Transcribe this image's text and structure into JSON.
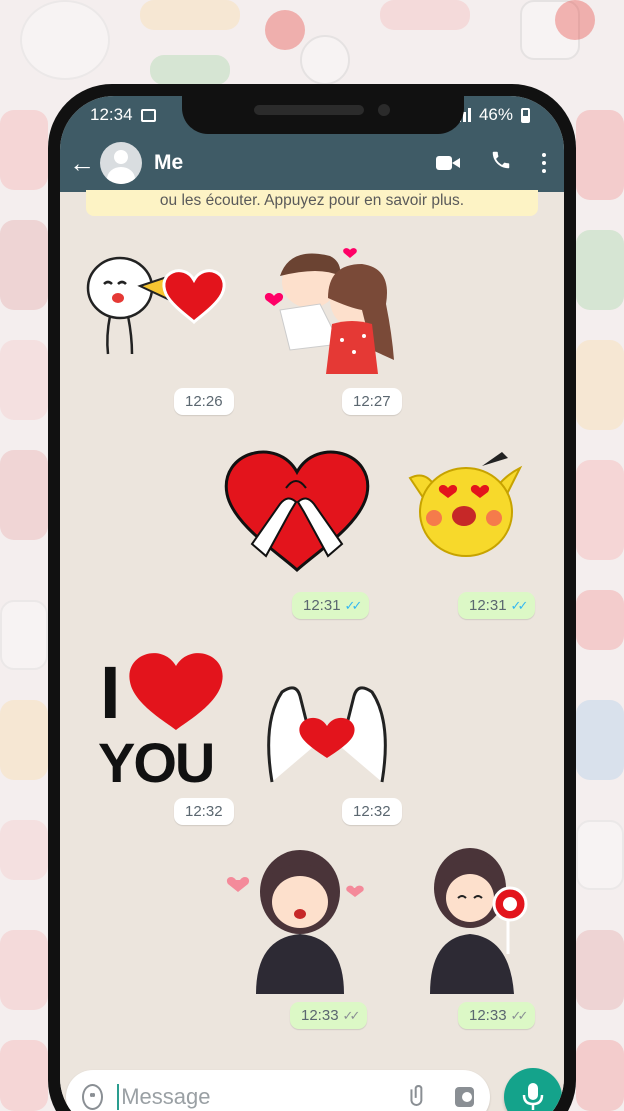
{
  "statusbar": {
    "time": "12:34",
    "battery": "46%"
  },
  "appbar": {
    "contact_name": "Me"
  },
  "chat": {
    "notice": "ou les écouter. Appuyez pour en savoir plus.",
    "stickers": [
      {
        "name": "shouting-smiley",
        "time": "12:26",
        "direction": "in"
      },
      {
        "name": "hugging-couple",
        "time": "12:27",
        "direction": "in"
      },
      {
        "name": "pinky-promise-heart",
        "time": "12:31",
        "direction": "out"
      },
      {
        "name": "heart-eyes-pikachu",
        "time": "12:31",
        "direction": "out"
      },
      {
        "name": "i-love-you",
        "time": "12:32",
        "direction": "in",
        "text_top": "I",
        "text_bottom": "YOU"
      },
      {
        "name": "heart-hands",
        "time": "12:32",
        "direction": "in"
      },
      {
        "name": "girl-with-hearts",
        "time": "12:33",
        "direction": "out"
      },
      {
        "name": "girl-with-lollipop",
        "time": "12:33",
        "direction": "out"
      }
    ]
  },
  "composer": {
    "placeholder": "Message"
  },
  "colors": {
    "header": "#3f5b66",
    "chat_bg": "#ece5dd",
    "outgoing": "#dcf8c6",
    "accent": "#14a38b",
    "read_ticks": "#34b7f1"
  },
  "icons": [
    "back-arrow-icon",
    "avatar-icon",
    "video-call-icon",
    "phone-call-icon",
    "more-options-icon",
    "emoji-icon",
    "attach-icon",
    "camera-icon",
    "mic-icon"
  ]
}
